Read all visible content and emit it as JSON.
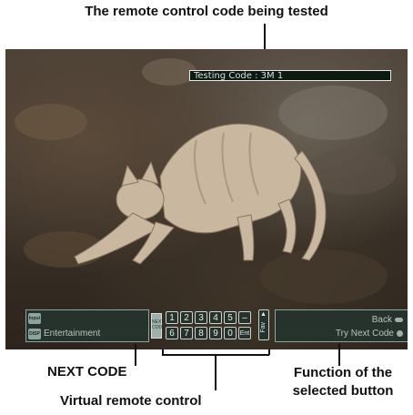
{
  "callouts": {
    "testing_code": "The remote control code being tested",
    "next_code": "NEXT CODE",
    "virtual_remote": "Virtual remote control",
    "function_line1": "Function of the",
    "function_line2": "selected button"
  },
  "screen": {
    "testing_code_text": "Testing Code : 3M 1"
  },
  "bar": {
    "input_tag": "Input",
    "disp_tag": "DISP",
    "source_label": "Entertainment",
    "next_button_label": "NEXT CODE",
    "keys_row1": [
      "1",
      "2",
      "3",
      "4",
      "5",
      "–"
    ],
    "keys_row2": [
      "6",
      "7",
      "8",
      "9",
      "0",
      "Ent"
    ],
    "fav_label": "Fav",
    "back_label": "Back",
    "try_next_label": "Try Next Code"
  },
  "colors": {
    "panel_bg": "#25332c",
    "panel_border": "#8da49a",
    "key_border": "#c9d3cf"
  }
}
